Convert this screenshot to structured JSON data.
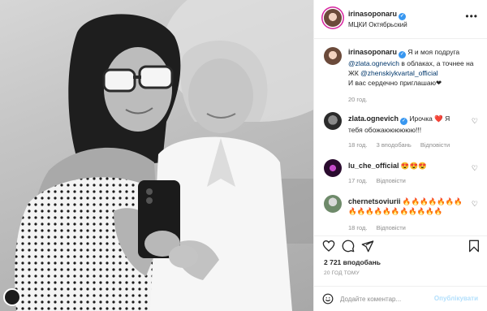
{
  "post": {
    "author": "irinasoponaru",
    "location": "МЦКИ Октябрьский",
    "more_icon": "more-horizontal-icon",
    "verified_icon": "verified-badge-icon",
    "caption": {
      "author": "irinasoponaru",
      "text_1": " Я и моя подруга",
      "mention_1": "@zlata.ognevich",
      "text_2": " в облаках, а точнее на ЖК ",
      "mention_2": "@zhenskiykvartal_official",
      "text_3": "И вас сердечно приглашаю",
      "text_3_suffix": "❤",
      "time": "20 год."
    },
    "comments": [
      {
        "user": "zlata.ognevich",
        "text": "Ирочка",
        "emoji": "❤️",
        "text_after": " Я тебя обожаюююююю!!!",
        "time": "18 год.",
        "likes": "3 вподобань",
        "reply": "Відповісти"
      },
      {
        "user": "lu_che_official",
        "text": "😍😍😍",
        "time": "17 год.",
        "reply": "Відповісти"
      },
      {
        "user": "chernetsoviurii",
        "text": "🔥🔥🔥🔥🔥🔥🔥🔥🔥🔥🔥🔥🔥🔥🔥🔥🔥🔥",
        "time": "18 год.",
        "reply": "Відповісти"
      }
    ],
    "likes": "2 721 вподобань",
    "time_ago": "20 ГОД ТОМУ",
    "add_comment": {
      "placeholder": "Додайте коментар...",
      "post_label": "Опублікувати"
    }
  },
  "colors": {
    "link": "#00376b",
    "muted": "#8e8e8e",
    "verified": "#3897f0",
    "post_disabled": "#b2dffc",
    "heart_red": "#ed4956"
  }
}
